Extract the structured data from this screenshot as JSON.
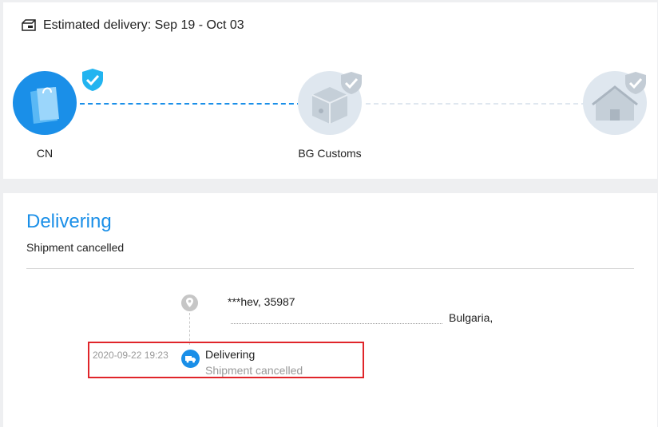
{
  "header": {
    "estimated_delivery": "Estimated delivery: Sep 19 - Oct 03"
  },
  "progress": {
    "nodes": [
      {
        "label": "CN",
        "state": "completed",
        "icon": "shopping-bag-icon"
      },
      {
        "label": "BG Customs",
        "state": "pending",
        "icon": "customs-box-icon"
      },
      {
        "label": "",
        "state": "pending",
        "icon": "house-icon"
      }
    ]
  },
  "status": {
    "title": "Delivering",
    "subtitle": "Shipment cancelled"
  },
  "timeline": {
    "address_line1": "***hev,  35987",
    "address_line2": "Bulgaria,",
    "events": [
      {
        "time": "2020-09-22 19:23",
        "title": "Delivering",
        "subtitle": "Shipment cancelled",
        "icon": "truck-icon"
      }
    ]
  },
  "colors": {
    "accent": "#1a8fe8",
    "highlight_border": "#e0252a",
    "inactive": "#dfe7ef"
  }
}
